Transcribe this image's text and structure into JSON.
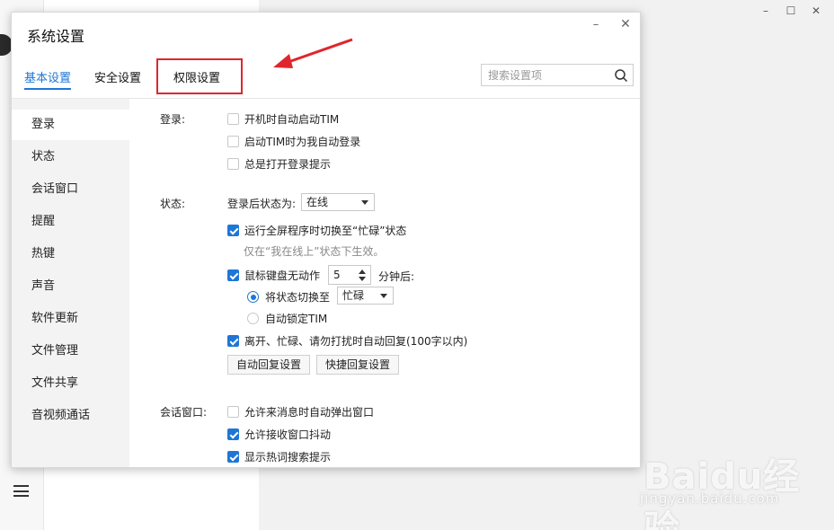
{
  "background": {
    "window_controls": [
      "–",
      "☐",
      "✕"
    ]
  },
  "watermark": {
    "brand": "Baidu经验",
    "url": "jingyan.baidu.com"
  },
  "dialog": {
    "title": "系统设置",
    "controls": {
      "minimize": "–",
      "close": "✕"
    },
    "tabs": [
      {
        "label": "基本设置",
        "active": true
      },
      {
        "label": "安全设置",
        "active": false
      },
      {
        "label": "权限设置",
        "active": false,
        "highlighted": true
      }
    ],
    "search": {
      "placeholder": "搜索设置项",
      "value": ""
    },
    "sidebar": [
      {
        "label": "登录",
        "active": true
      },
      {
        "label": "状态",
        "active": false
      },
      {
        "label": "会话窗口",
        "active": false
      },
      {
        "label": "提醒",
        "active": false
      },
      {
        "label": "热键",
        "active": false
      },
      {
        "label": "声音",
        "active": false
      },
      {
        "label": "软件更新",
        "active": false
      },
      {
        "label": "文件管理",
        "active": false
      },
      {
        "label": "文件共享",
        "active": false
      },
      {
        "label": "音视频通话",
        "active": false
      }
    ],
    "login": {
      "section_label": "登录:",
      "options": [
        {
          "label": "开机时自动启动TIM",
          "checked": false
        },
        {
          "label": "启动TIM时为我自动登录",
          "checked": false
        },
        {
          "label": "总是打开登录提示",
          "checked": false
        }
      ]
    },
    "status": {
      "section_label": "状态:",
      "after_login_label": "登录后状态为:",
      "after_login_value": "在线",
      "fullscreen_busy": {
        "label": "运行全屏程序时切换至“忙碌”状态",
        "checked": true
      },
      "fullscreen_hint": "仅在“我在线上”状态下生效。",
      "idle": {
        "label": "鼠标键盘无动作",
        "checked": true,
        "minutes": "5",
        "suffix": "分钟后:"
      },
      "switch_status": {
        "label": "将状态切换至",
        "selected": true,
        "value": "忙碌"
      },
      "auto_lock": {
        "label": "自动锁定TIM",
        "selected": false
      },
      "auto_reply": {
        "label": "离开、忙碌、请勿打扰时自动回复(100字以内)",
        "checked": true
      },
      "buttons": {
        "auto_reply_settings": "自动回复设置",
        "quick_reply_settings": "快捷回复设置"
      }
    },
    "session": {
      "section_label": "会话窗口:",
      "options": [
        {
          "label": "允许来消息时自动弹出窗口",
          "checked": false
        },
        {
          "label": "允许接收窗口抖动",
          "checked": true
        },
        {
          "label": "显示热词搜索提示",
          "checked": true
        }
      ]
    },
    "colors": {
      "accent": "#1e76d6",
      "highlight_box": "#e0262c",
      "arrow": "#e0262c"
    }
  }
}
